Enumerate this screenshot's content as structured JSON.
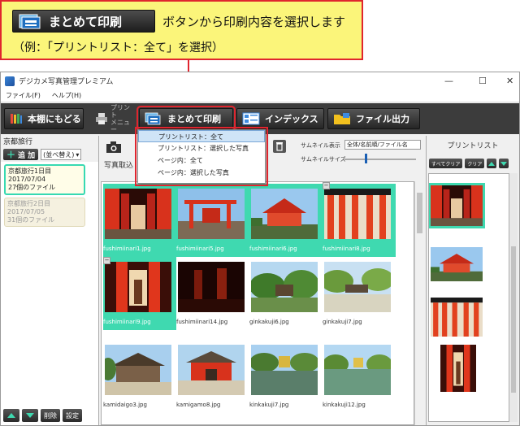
{
  "callout": {
    "button_label": "まとめて印刷",
    "text": "ボタンから印刷内容を選択します",
    "sub": "（例：「プリントリスト：全て」を選択）"
  },
  "window": {
    "title": "デジカメ写真管理プレミアム",
    "controls": [
      "—",
      "☐",
      "✕"
    ],
    "menu": [
      "ファイル(F)",
      "ヘルプ(H)"
    ]
  },
  "toolbar": {
    "back_label": "本棚にもどる",
    "print_menu_label": "プリント\nメニュー",
    "batch_print_label": "まとめて印刷",
    "index_label": "インデックス",
    "file_output_label": "ファイル出力"
  },
  "dropdown": {
    "items": [
      "プリントリスト：全て",
      "プリントリスト：選択した写真",
      "ページ内：全て",
      "ページ内：選択した写真"
    ],
    "selected_index": 0
  },
  "left_panel": {
    "title": "京都旅行",
    "add_label": "追 加",
    "sort_label": "(並べ替え)",
    "albums": [
      {
        "name": "京都旅行1日目",
        "date": "2017/07/04",
        "count": "27個のファイル",
        "active": true
      },
      {
        "name": "京都旅行2日目",
        "date": "2017/07/05",
        "count": "31個のファイル",
        "active": false
      }
    ],
    "bottom_buttons": [
      "削除",
      "設定"
    ]
  },
  "center": {
    "photo_import_label": "写真取込",
    "thumb_display_label": "サムネイル表示",
    "thumb_display_value": "全体/名前順/ファイル名",
    "thumb_size_label": "サムネイルサイズ",
    "photos": [
      {
        "file": "fushimiinari1.jpg",
        "selected": true,
        "scene": "tunnel"
      },
      {
        "file": "fushimiinari5.jpg",
        "selected": true,
        "scene": "shrine"
      },
      {
        "file": "fushimiinari6.jpg",
        "selected": true,
        "scene": "shrine2"
      },
      {
        "file": "fushimiinari8.jpg",
        "selected": true,
        "scene": "gates"
      },
      {
        "file": "fushimiinari9.jpg",
        "selected": true,
        "scene": "tunnel-tall"
      },
      {
        "file": "fushimiinari14.jpg",
        "selected": false,
        "scene": "dark-red"
      },
      {
        "file": "ginkakuji6.jpg",
        "selected": false,
        "scene": "garden"
      },
      {
        "file": "ginkakuji7.jpg",
        "selected": false,
        "scene": "garden2"
      },
      {
        "file": "kamidaigo3.jpg",
        "selected": false,
        "scene": "temple"
      },
      {
        "file": "kamigamo8.jpg",
        "selected": false,
        "scene": "gate-red"
      },
      {
        "file": "kinkakuji7.jpg",
        "selected": false,
        "scene": "pond"
      },
      {
        "file": "kinkakuji12.jpg",
        "selected": false,
        "scene": "pond2"
      }
    ]
  },
  "right_panel": {
    "title": "プリントリスト",
    "clear_all_label": "すべてクリア",
    "clear_label": "クリア"
  },
  "colors": {
    "accent_red": "#e0252e",
    "callout_bg": "#fbf57a",
    "selection": "#3fd9b0",
    "toolbar_bg": "#3c3c3c"
  }
}
